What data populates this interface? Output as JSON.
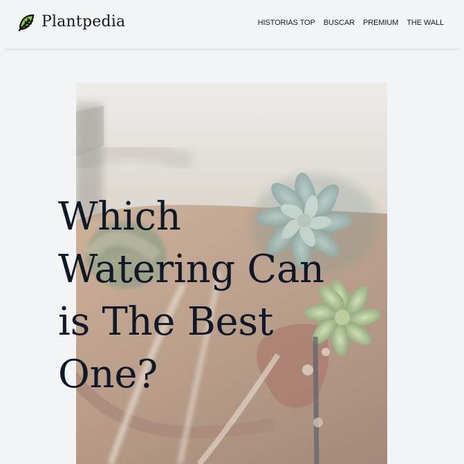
{
  "header": {
    "brand_name": "Plantpedia",
    "brand_icon": "leaf-icon",
    "nav_items": [
      {
        "label": "HISTORIAS TOP"
      },
      {
        "label": "BUSCAR"
      },
      {
        "label": "PREMIUM"
      },
      {
        "label": "THE WALL"
      }
    ]
  },
  "article": {
    "title": "Which Watering Can is The Best One?",
    "hero_image_subject": "succulents-photo"
  },
  "theme": {
    "background": "#f3f4f6",
    "text": "#111827",
    "leaf_green": "#8ccf3e"
  }
}
